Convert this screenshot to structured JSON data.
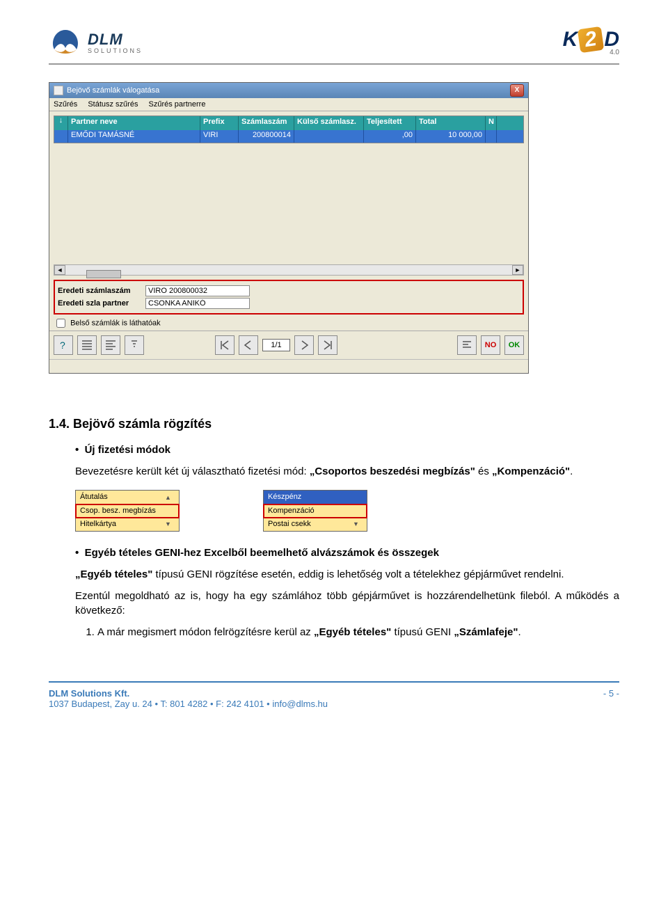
{
  "header": {
    "dlm_name": "DLM",
    "dlm_sub": "SOLUTIONS",
    "k2d_k": "K",
    "k2d_2": "2",
    "k2d_d": "D",
    "k2d_version": "4.0"
  },
  "win": {
    "title": "Bejövő számlák válogatása",
    "close": "X",
    "menu": {
      "m1": "Szűrés",
      "m2": "Státusz szűrés",
      "m3": "Szűrés partnerre"
    },
    "cols": {
      "sort": "↓",
      "c1": "Partner neve",
      "c2": "Prefix",
      "c3": "Számlaszám",
      "c4": "Külső számlasz.",
      "c5": "Teljesített",
      "c6": "Total",
      "c7": "N"
    },
    "row": {
      "c1": "EMŐDI TAMÁSNÉ",
      "c2": "VIRI",
      "c3": "200800014",
      "c4": "",
      "c5": ",00",
      "c6": "10 000,00"
    },
    "form": {
      "l1": "Eredeti számlaszám",
      "v1": "VIRO 200800032",
      "l2": "Eredeti szla partner",
      "v2": "CSONKA ANIKÓ"
    },
    "chk": "Belső számlák is láthatóak",
    "pager": "1/1",
    "no": "NO",
    "ok": "OK"
  },
  "body": {
    "h2_num": "1.4.",
    "h2_title": "Bejövő számla rögzítés",
    "h3": "Új fizetési módok",
    "p1a": "Bevezetésre került két új választható fizetési mód: ",
    "p1b": "„Csoportos beszedési megbízás\"",
    "p1c": " és ",
    "p1d": "„Kompenzáció\"",
    "p1e": ".",
    "dd1": {
      "o1": "Átutalás",
      "o2": "Csop. besz. megbízás",
      "o3": "Hitelkártya"
    },
    "dd2": {
      "o1": "Készpénz",
      "o2": "Kompenzáció",
      "o3": "Postai csekk"
    },
    "h3b": "Egyéb tételes GENI-hez Excelből beemelhető alvázszámok és összegek",
    "p2a": "„Egyéb tételes\"",
    "p2b": " típusú GENI rögzítése esetén, eddig is lehetőség volt a tételekhez gépjárművet rendelni.",
    "p3": "Ezentúl megoldható az is, hogy ha egy számlához több gépjárművet is hozzárendelhetünk fileból. A működés a következő:",
    "li1a": "A már megismert módon felrögzítésre kerül az ",
    "li1b": "„Egyéb tételes\"",
    "li1c": " típusú GENI ",
    "li1d": "„Számlafeje\"",
    "li1e": "."
  },
  "footer": {
    "company": "DLM Solutions Kft.",
    "addr": "1037 Budapest, Zay u. 24",
    "tel": "T: 801 4282",
    "fax": "F: 242 4101",
    "email": "info@dlms.hu",
    "dot": " • ",
    "page": "- 5 -"
  }
}
